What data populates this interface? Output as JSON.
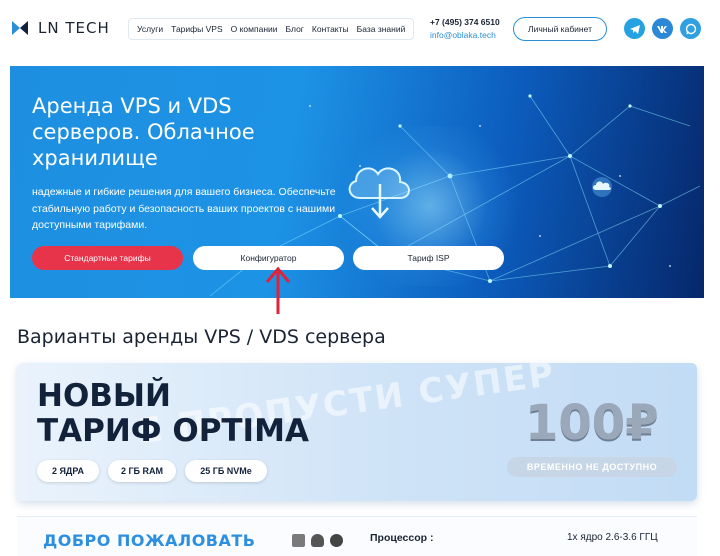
{
  "brand": {
    "logo_text": "LN TECH"
  },
  "nav": {
    "items": [
      {
        "label": "Услуги"
      },
      {
        "label": "Тарифы VPS"
      },
      {
        "label": "О компании"
      },
      {
        "label": "Блог"
      },
      {
        "label": "Контакты"
      },
      {
        "label": "База знаний"
      }
    ]
  },
  "contacts": {
    "phone": "+7 (495) 374 6510",
    "email": "info@oblaka.tech"
  },
  "header": {
    "cabinet_label": "Личный кабинет"
  },
  "social": [
    "telegram-icon",
    "vk-icon",
    "whatsapp-icon"
  ],
  "hero": {
    "title": "Аренда VPS и VDS серверов. Облачное хранилище",
    "subtitle": "надежные и гибкие решения для вашего бизнеса. Обеспечьте стабильную работу и безопасность ваших проектов с нашими доступными тарифами.",
    "buttons": {
      "standard": "Стандартные тарифы",
      "configurator": "Конфигуратор",
      "isp": "Тариф ISP"
    }
  },
  "section": {
    "title": "Варианты аренды VPS / VDS сервера"
  },
  "promo": {
    "background_text": "Е ПРОПУСТИ СУПЕР",
    "title_line1": "НОВЫЙ",
    "title_line2": "ТАРИФ OPTIMA",
    "specs": [
      "2 ЯДРА",
      "2 ГБ RAM",
      "25 ГБ NVMe"
    ],
    "price": "100₽",
    "status": "ВРЕМЕННО НЕ ДОСТУПНО"
  },
  "card": {
    "welcome": "ДОБРО ПОЖАЛОВАТЬ",
    "cpu_label": "Процессор :",
    "cpu_value": "1х ядро 2.6-3.6 ГГЦ"
  },
  "colors": {
    "accent": "#2c8fd6",
    "red": "#e7344a",
    "dark": "#12223a"
  }
}
